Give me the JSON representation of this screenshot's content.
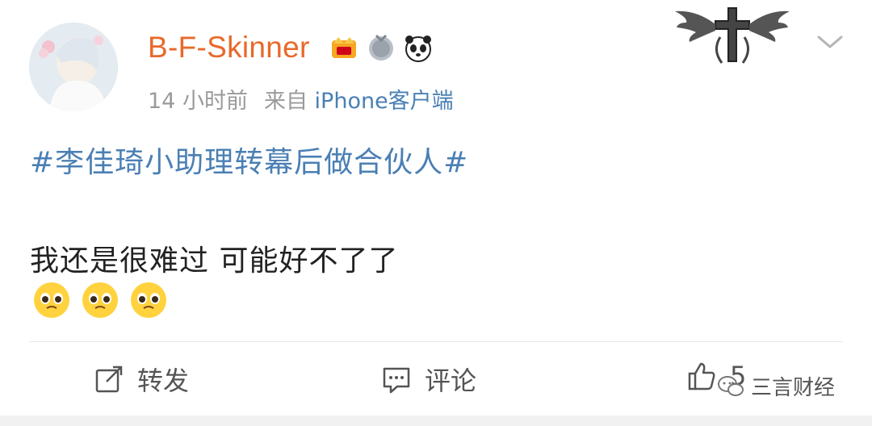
{
  "post": {
    "username": "B-F-Skinner",
    "time": "14 小时前",
    "source_prefix": "来自",
    "source_client": "iPhone客户端",
    "topic": "#李佳琦小助理转幕后做合伙人#",
    "text": "我还是很难过 可能好不了了",
    "emojis": [
      "pleading-face",
      "pleading-face",
      "pleading-face"
    ]
  },
  "actions": {
    "repost_label": "转发",
    "comment_label": "评论",
    "like_count": "5"
  },
  "watermark": {
    "text": "三言财经"
  },
  "colors": {
    "username": "#e8692a",
    "link": "#4a7fb4",
    "meta": "#9a9a9a",
    "text": "#222222"
  }
}
